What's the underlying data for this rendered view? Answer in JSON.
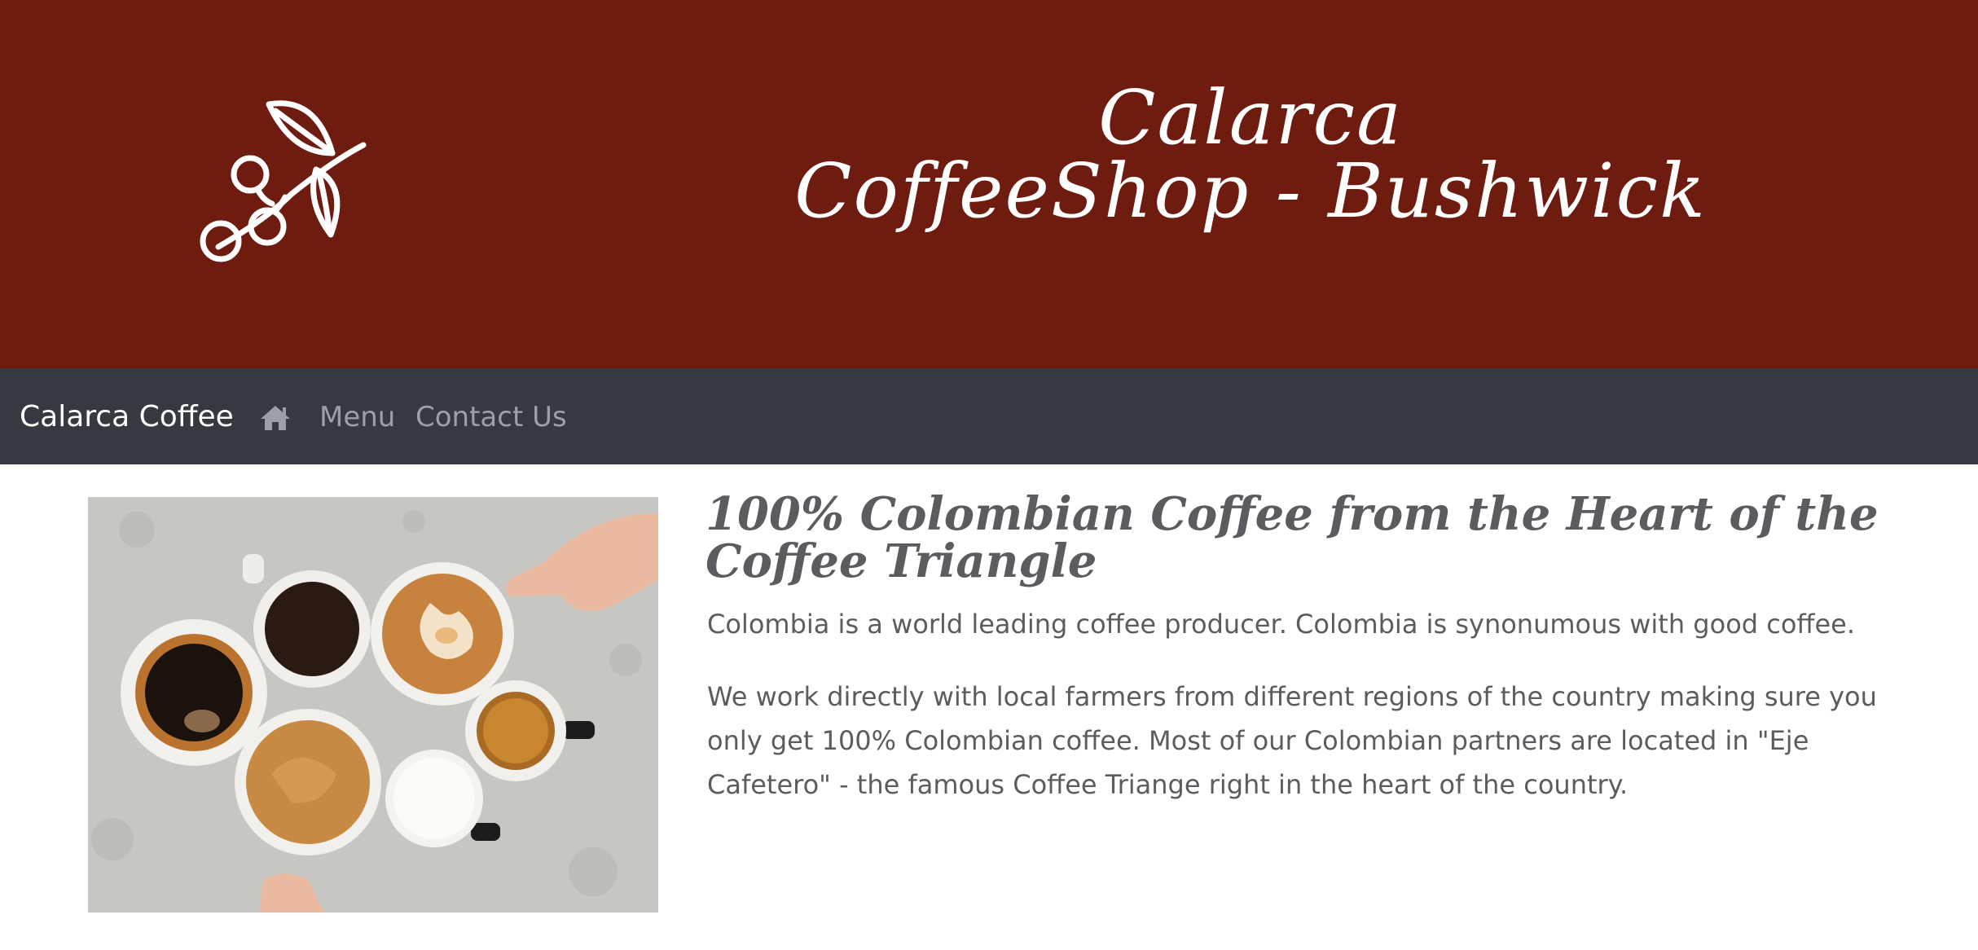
{
  "banner": {
    "title_line1": "Calarca",
    "title_line2": "CoffeeShop - Bushwick",
    "logo_icon": "coffee-branch-icon",
    "background": "#6e1b10"
  },
  "navbar": {
    "brand": "Calarca Coffee",
    "home_icon": "home-icon",
    "links": [
      "Menu",
      "Contact Us"
    ],
    "background": "#343a40"
  },
  "main": {
    "image_description_icon": "coffee-cups-photo",
    "headline": "100% Colombian Coffee from the Heart of the Coffee Triangle",
    "paragraph1": "Colombia is a world leading coffee producer. Colombia is synonumous with good coffee.",
    "paragraph2": "We work directly with local farmers from different regions of the country making sure you only get 100% Colombian coffee. Most of our Colombian partners are located in \"Eje Cafetero\" - the famous Coffee Triange right in the heart of the country."
  }
}
